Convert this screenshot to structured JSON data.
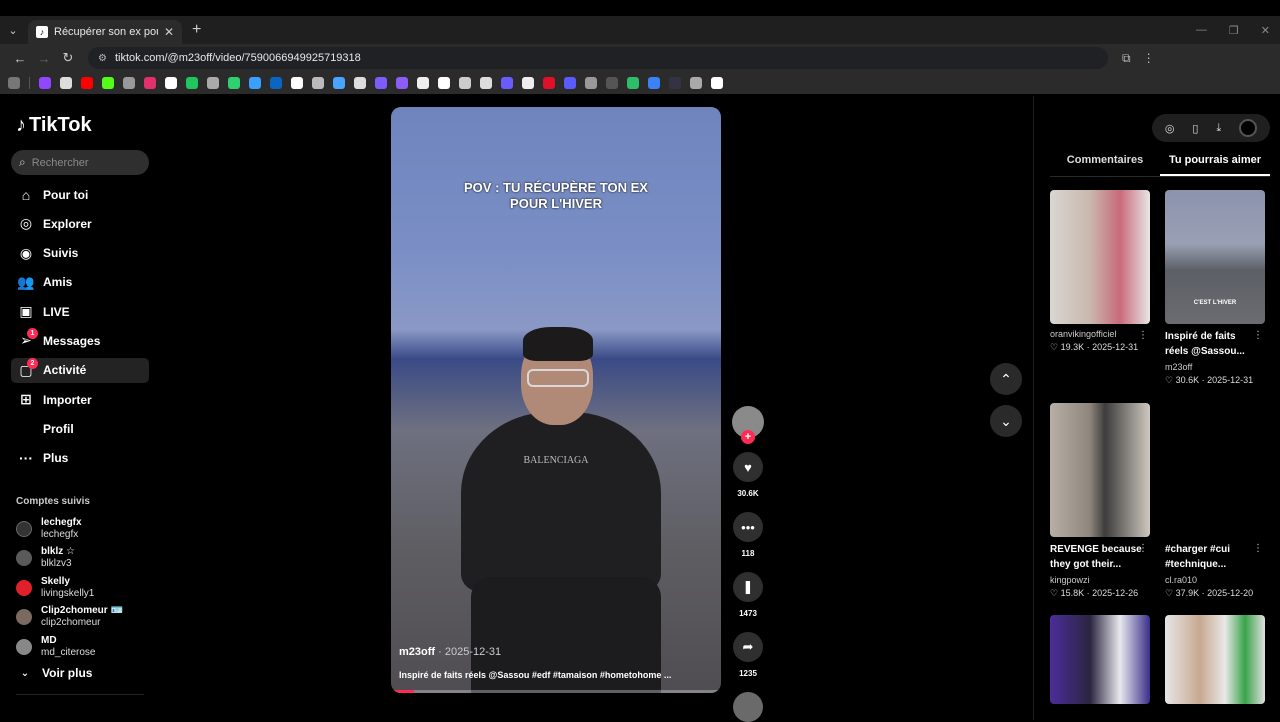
{
  "browser": {
    "tab_title": "Récupérer son ex pour l'hiver",
    "url": "tiktok.com/@m23off/video/7590066949925719318"
  },
  "sidebar": {
    "logo": "TikTok",
    "search_placeholder": "Rechercher",
    "menu": [
      {
        "label": "Pour toi",
        "icon": "home-icon"
      },
      {
        "label": "Explorer",
        "icon": "compass-icon"
      },
      {
        "label": "Suivis",
        "icon": "following-icon"
      },
      {
        "label": "Amis",
        "icon": "friends-icon"
      },
      {
        "label": "LIVE",
        "icon": "live-icon"
      },
      {
        "label": "Messages",
        "icon": "messages-icon",
        "badge": "1"
      },
      {
        "label": "Activité",
        "icon": "activity-icon",
        "badge": "2"
      },
      {
        "label": "Importer",
        "icon": "upload-icon"
      },
      {
        "label": "Profil",
        "icon": "profile-icon"
      },
      {
        "label": "Plus",
        "icon": "more-icon"
      }
    ],
    "following_header": "Comptes suivis",
    "following": [
      {
        "name": "lechegfx",
        "user": "lechegfx",
        "color": "#333333"
      },
      {
        "name": "blklz ☆",
        "user": "blklzv3",
        "color": "#5a5a5a"
      },
      {
        "name": "Skelly",
        "user": "livingskelly1",
        "color": "#e0202a"
      },
      {
        "name": "Clip2chomeur 🪪",
        "user": "clip2chomeur",
        "color": "#7a6a60"
      },
      {
        "name": "MD",
        "user": "md_citerose",
        "color": "#888888"
      }
    ],
    "see_more": "Voir plus"
  },
  "video": {
    "caption_line1": "POV : TU RÉCUPÈRE TON EX",
    "caption_line2": "POUR L'HIVER",
    "shirt_text": "BALENCIAGA",
    "author": "m23off",
    "date": "· 2025-12-31",
    "description": "Inspiré de faits réels @Sassou #edf #tamaison #hometohome ...",
    "progress": 0.07
  },
  "actions": {
    "likes": "30.6K",
    "comments": "118",
    "saves": "1473",
    "shares": "1235"
  },
  "right_panel": {
    "tab_comments": "Commentaires",
    "tab_suggested": "Tu pourrais aimer",
    "cards": [
      {
        "title": "",
        "user": "oranvikingofficiel",
        "likes": "19.3K",
        "date": "2025-12-31",
        "thumb": "#b9a89a"
      },
      {
        "title": "Inspiré de faits réels @Sassou...",
        "user": "m23off",
        "likes": "30.6K",
        "date": "2025-12-31",
        "thumb": "#6f7590",
        "thumb_text": "C'EST L'HIVER"
      },
      {
        "title": "REVENGE because they got their...",
        "user": "kingpowzi",
        "likes": "15.8K",
        "date": "2025-12-26",
        "thumb": "#8a7e72"
      },
      {
        "title": "#charger #cui #technique...",
        "user": "cl.ra010",
        "likes": "37.9K",
        "date": "2025-12-20",
        "thumb": "#000000"
      },
      {
        "title": "",
        "user": "",
        "likes": "",
        "date": "",
        "thumb": "#3a2a6a"
      },
      {
        "title": "",
        "user": "",
        "likes": "",
        "date": "",
        "thumb": "#d8d8d8"
      }
    ]
  }
}
